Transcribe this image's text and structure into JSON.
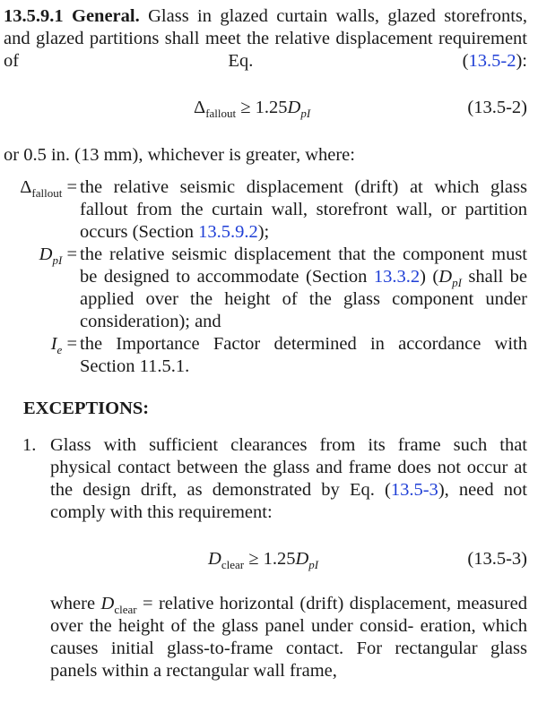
{
  "section": {
    "heading": "13.5.9.1 General.",
    "intro": "Glass in glazed curtain walls, glazed storefronts, and glazed partitions shall meet the relative displacement requirement of Eq. (",
    "intro_ref": "13.5-2",
    "intro_end": "):"
  },
  "eq1": {
    "lhs_symbol": "Δ",
    "lhs_sub": "fallout",
    "operator": " ≥ 1.25",
    "rhs_symbol": "D",
    "rhs_sub": "pI",
    "number": "(13.5-2)"
  },
  "after_eq1": "or 0.5 in. (13 mm), whichever is greater, where:",
  "definitions": [
    {
      "symbol": "Δ",
      "sub": "fallout",
      "text": "the relative seismic displacement (drift) at which glass fallout from the curtain wall, storefront wall, or partition occurs (Section ",
      "ref": "13.5.9.2",
      "end": ");"
    },
    {
      "symbol": "D",
      "sub": "pI",
      "text": "the relative seismic displacement that the component must be designed to accommodate (Section ",
      "ref": "13.3.2",
      "mid": ") (",
      "mid_symbol": "D",
      "mid_sub": "pI",
      "end": " shall be applied over the height of the glass component under consideration); and"
    },
    {
      "symbol": "I",
      "sub": "e",
      "text": "the Importance Factor determined in accordance with Section 11.5.1."
    }
  ],
  "exceptions": {
    "title": "EXCEPTIONS:",
    "item_number": "1.",
    "item_text": "Glass with sufficient clearances from its frame such that physical contact between the glass and frame does not occur at the design drift, as demonstrated by Eq. (",
    "item_ref": "13.5-3",
    "item_end": "), need not comply with this requirement:"
  },
  "eq2": {
    "lhs_symbol": "D",
    "lhs_sub": "clear",
    "operator": " ≥ 1.25",
    "rhs_symbol": "D",
    "rhs_sub": "pI",
    "number": "(13.5-3)"
  },
  "where_clause": {
    "lead": "where ",
    "symbol": "D",
    "sub": "clear",
    "text": " = relative horizontal (drift) displacement, measured over the height of the glass panel under consid- eration, which causes initial glass-to-frame contact. For rectangular glass panels within a rectangular wall frame,"
  }
}
